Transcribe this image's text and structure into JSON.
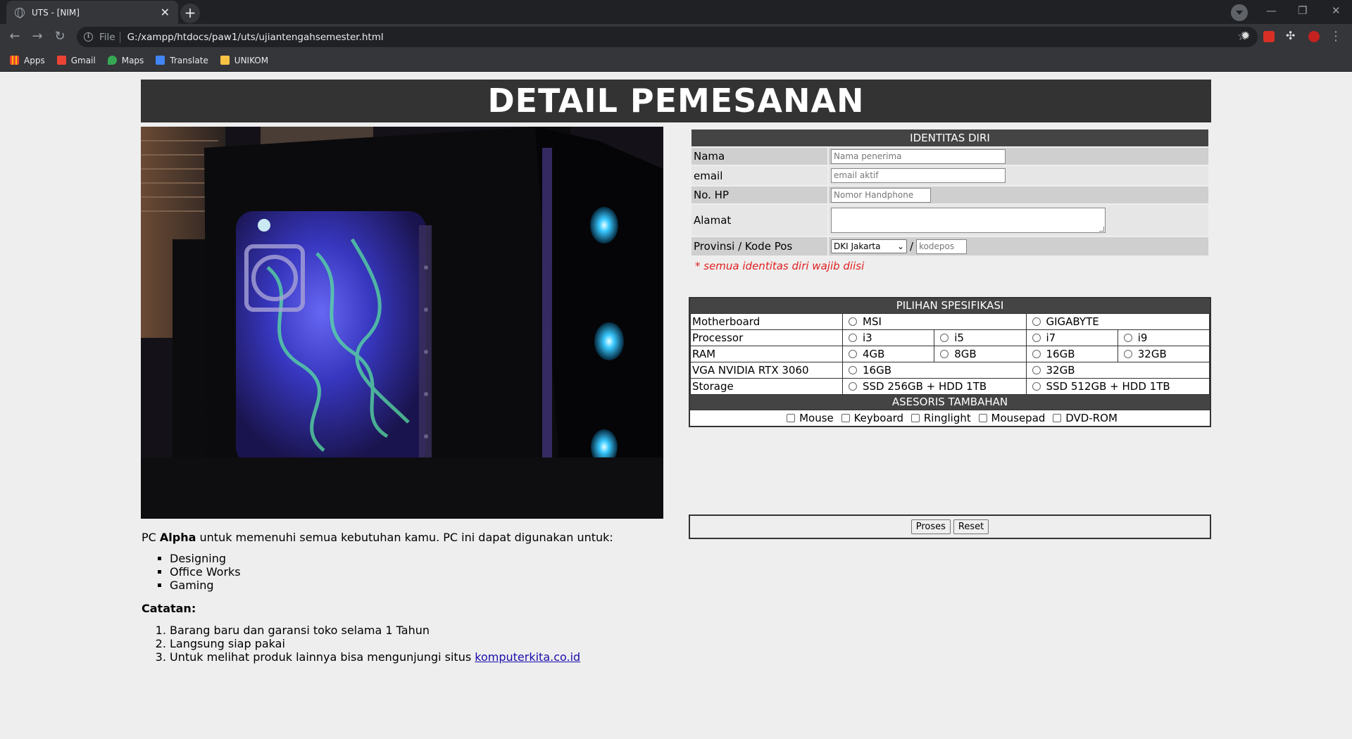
{
  "browser": {
    "tab_title": "UTS - [NIM]",
    "url_scheme": "File",
    "url": "G:/xampp/htdocs/paw1/uts/ujiantengahsemester.html",
    "bookmarks": [
      {
        "label": "Apps",
        "icon": "apps-grid-icon"
      },
      {
        "label": "Gmail",
        "icon": "gmail-icon"
      },
      {
        "label": "Maps",
        "icon": "maps-pin-icon"
      },
      {
        "label": "Translate",
        "icon": "translate-icon"
      },
      {
        "label": "UNIKOM",
        "icon": "folder-icon"
      }
    ]
  },
  "page": {
    "title": "DETAIL PEMESANAN",
    "intro_prefix": "PC ",
    "intro_bold": "Alpha",
    "intro_suffix": " untuk memenuhi semua kebutuhan kamu. PC ini dapat digunakan untuk:",
    "uses": [
      "Designing",
      "Office Works",
      "Gaming"
    ],
    "notes_heading": "Catatan:",
    "notes": [
      "Barang baru dan garansi toko selama 1 Tahun",
      "Langsung siap pakai",
      "Untuk melihat produk lainnya bisa mengunjungi situs "
    ],
    "notes_link": "komputerkita.co.id"
  },
  "identity": {
    "heading": "IDENTITAS DIRI",
    "name_label": "Nama",
    "name_placeholder": "Nama penerima",
    "email_label": "email",
    "email_placeholder": "email aktif",
    "phone_label": "No. HP",
    "phone_placeholder": "Nomor Handphone",
    "address_label": "Alamat",
    "province_label": "Provinsi / Kode Pos",
    "province_selected": "DKI Jakarta",
    "slash": "/",
    "postal_placeholder": "kodepos",
    "required_note": "* semua identitas diri wajib diisi"
  },
  "specs": {
    "heading": "PILIHAN SPESIFIKASI",
    "motherboard_label": "Motherboard",
    "motherboard_options": [
      "MSI",
      "GIGABYTE"
    ],
    "processor_label": "Processor",
    "processor_options": [
      "i3",
      "i5",
      "i7",
      "i9"
    ],
    "ram_label": "RAM",
    "ram_options": [
      "4GB",
      "8GB",
      "16GB",
      "32GB"
    ],
    "vga_label": "VGA NVIDIA RTX 3060",
    "vga_options": [
      "16GB",
      "32GB"
    ],
    "storage_label": "Storage",
    "storage_options": [
      "SSD 256GB + HDD 1TB",
      "SSD 512GB + HDD 1TB"
    ],
    "accessories_heading": "ASESORIS TAMBAHAN",
    "accessories": [
      "Mouse",
      "Keyboard",
      "Ringlight",
      "Mousepad",
      "DVD-ROM"
    ]
  },
  "actions": {
    "submit": "Proses",
    "reset": "Reset"
  }
}
